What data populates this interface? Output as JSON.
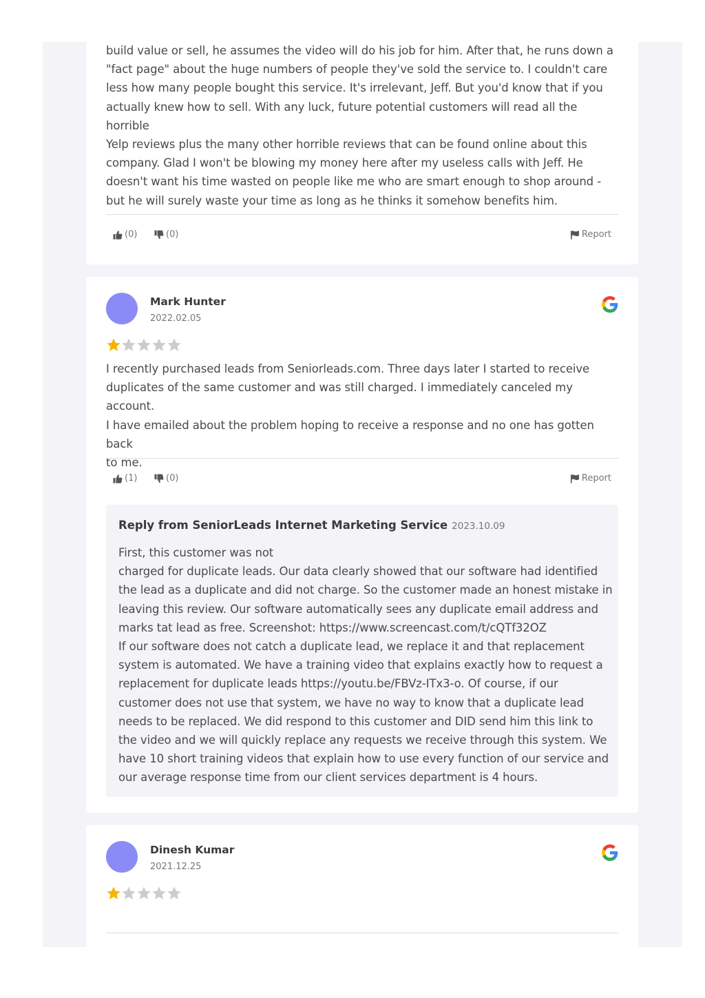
{
  "reviews": [
    {
      "text_lines": [
        "build value or sell, he assumes the video will do his job for him. After that, he runs down a",
        "\"fact page\" about the huge numbers of people they've sold the service to. I couldn't care",
        "less how many people bought this service. It's irrelevant, Jeff. But you'd know that if you",
        "actually knew how to sell. With any luck, future potential customers will read all the horrible",
        "Yelp reviews plus the many other horrible reviews that can be found online about this",
        "company. Glad I won't be blowing my money here after my useless calls with Jeff. He",
        "doesn't want his time wasted on people like me who are smart enough to shop around -",
        "but he will surely waste your time as long as he thinks it somehow benefits him."
      ],
      "likes": "(0)",
      "dislikes": "(0)",
      "report_label": "Report"
    },
    {
      "author": "Mark Hunter",
      "date": "2022.02.05",
      "rating": 1,
      "text_lines": [
        "I recently purchased leads from Seniorleads.com. Three days later I started to receive",
        "duplicates of the same customer and was still charged. I immediately canceled my account.",
        "I have emailed about the problem hoping to receive a response and no one has gotten back",
        "to me."
      ],
      "likes": "(1)",
      "dislikes": "(0)",
      "report_label": "Report",
      "reply": {
        "title": "Reply from SeniorLeads Internet Marketing Service",
        "date": "2023.10.09",
        "lines": [
          "First, this customer was not",
          "charged for duplicate leads. Our data clearly showed that our software had identified",
          "the lead as a duplicate and did not charge. So the customer made an honest mistake in",
          "leaving this review. Our software automatically sees any duplicate email address and",
          "marks tat lead as free. Screenshot: https://www.screencast.com/t/cQTf32OZ",
          "If our software does not catch a duplicate lead, we replace it and that replacement",
          "system is automated. We have a training video that explains exactly how to request a",
          "replacement for duplicate leads https://youtu.be/FBVz-ITx3-o. Of course, if our",
          "customer does not use that system, we have no way to know that a duplicate lead",
          "needs to be replaced. We did respond to this customer and DID send him this link to",
          "the video and we will quickly replace any requests we receive through this system. We",
          "have 10 short training videos that explain how to use every function of our service and",
          "our average response time from our client services department is 4 hours."
        ]
      }
    },
    {
      "author": "Dinesh Kumar",
      "date": "2021.12.25",
      "rating": 1
    }
  ],
  "colors": {
    "star_filled": "#f5b400",
    "star_empty": "#cccccc",
    "avatar": "#8b8bf7",
    "page_bg": "#f4f4f8"
  },
  "icons": {
    "source": "google-icon",
    "like": "thumbs-up-icon",
    "dislike": "thumbs-down-icon",
    "report": "flag-icon"
  }
}
